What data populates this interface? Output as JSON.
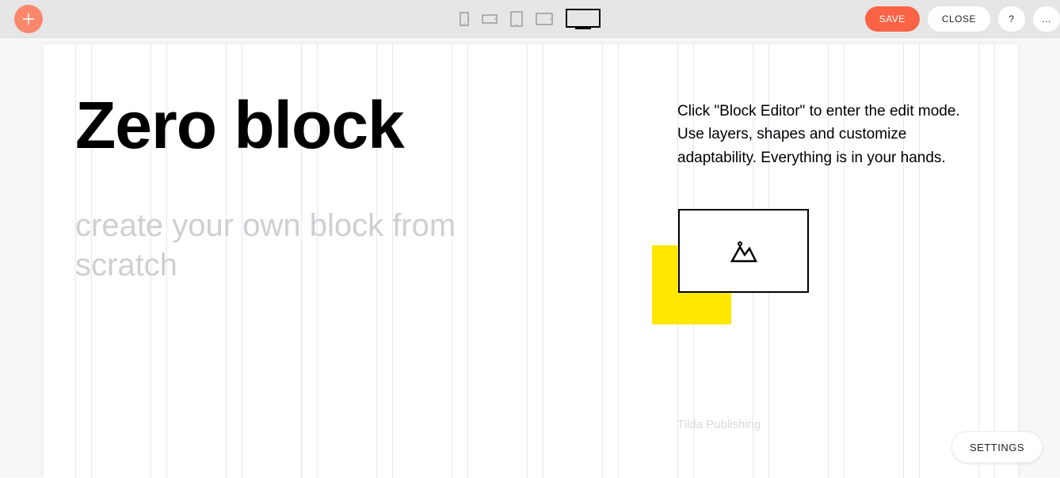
{
  "toolbar": {
    "save_label": "SAVE",
    "close_label": "CLOSE",
    "help_label": "?",
    "more_label": "..."
  },
  "devices": [
    {
      "name": "phone-portrait",
      "active": false
    },
    {
      "name": "phone-landscape",
      "active": false
    },
    {
      "name": "tablet-portrait",
      "active": false
    },
    {
      "name": "tablet-landscape",
      "active": false
    },
    {
      "name": "desktop",
      "active": true
    }
  ],
  "page": {
    "heading": "Zero block",
    "subheading": "create your own block from scratch",
    "instructions": "Click \"Block Editor\" to enter the edit mode. Use layers, shapes and customize adaptability. Everything is in your hands.",
    "credit": "Tilda Publishing",
    "graphic": {
      "yellow_color": "#ffe700",
      "image_placeholder": "mountain-image-icon"
    }
  },
  "settings_label": "SETTINGS"
}
